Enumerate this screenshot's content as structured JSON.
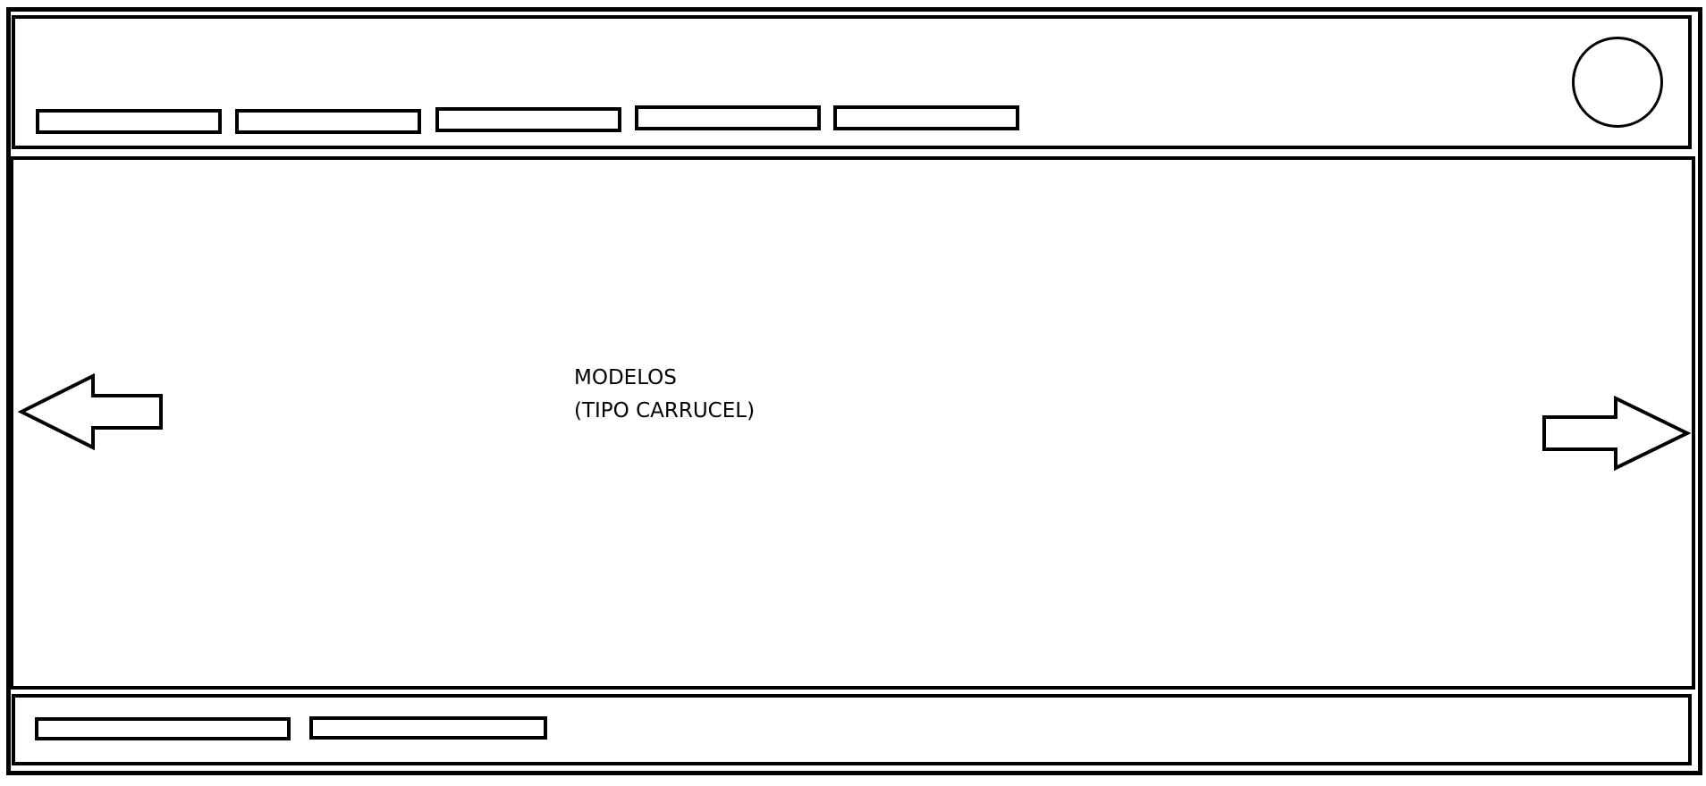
{
  "carousel": {
    "label_line1": "MODELOS",
    "label_line2": "(TIPO CARRUCEL)"
  },
  "icons": {
    "prev": "arrow-left-icon",
    "next": "arrow-right-icon",
    "avatar": "user-avatar-circle"
  },
  "colors": {
    "stroke": "#000000",
    "background": "#ffffff"
  }
}
